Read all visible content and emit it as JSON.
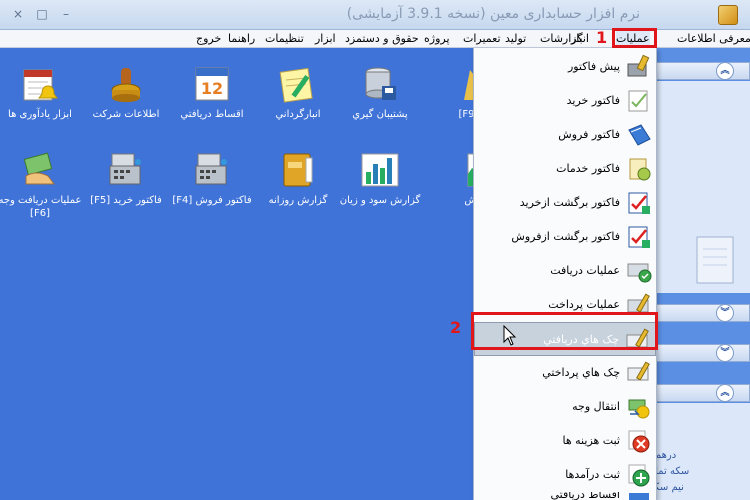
{
  "window": {
    "title": "نرم افزار حسابداری معین (نسخه 3.9.1 آزمایشی)",
    "controls": [
      "–",
      "□",
      "×"
    ]
  },
  "menubar": {
    "items": [
      "معرفی اطلاعات",
      "عملیات",
      "انبار",
      "گزارشات",
      "تولید",
      "تعمیرات",
      "پروژه",
      "حقوق و دستمزد",
      "ابزار",
      "تنظیمات",
      "راهنما",
      "خروج"
    ],
    "active": "عملیات",
    "callout_number": "1"
  },
  "desktop": {
    "row1": [
      {
        "label": "ابزار یادآوری ها",
        "icon": "calendar-bell-icon"
      },
      {
        "label": "اطلاعات شرکت",
        "icon": "stamp-icon"
      },
      {
        "label": "اقساط دريافتي",
        "icon": "calendar-12-icon"
      },
      {
        "label": "انبارگرداني",
        "icon": "notepad-pencil-icon"
      },
      {
        "label": "پشتيبان گيري",
        "icon": "database-save-icon"
      },
      {
        "label": "د ها [F9]",
        "icon": "folder-icon"
      }
    ],
    "row2": [
      {
        "label": "عمليات دريافت وجه [F6]",
        "icon": "hand-money-icon"
      },
      {
        "label": "فاکتور خريد [F5]",
        "icon": "cash-register-icon"
      },
      {
        "label": "فاکتور فروش [F4]",
        "icon": "cash-register-icon"
      },
      {
        "label": "گزارش روزانه",
        "icon": "book-icon"
      },
      {
        "label": "گزارش سود و زيان",
        "icon": "bar-chart-icon"
      },
      {
        "label": "فروش",
        "icon": "area-chart-icon"
      }
    ]
  },
  "dropdown": {
    "items": [
      {
        "label": "پيش فاکتور",
        "icon": "pen-tool-icon"
      },
      {
        "label": "فاکتور خريد",
        "icon": "check-paper-icon"
      },
      {
        "label": "فاکتور فروش",
        "icon": "blue-book-icon"
      },
      {
        "label": "فاکتور خدمات",
        "icon": "gear-paper-icon"
      },
      {
        "label": "فاکتور برگشت ازخريد",
        "icon": "red-check-icon"
      },
      {
        "label": "فاکتور برگشت ازفروش",
        "icon": "red-check-icon"
      },
      {
        "label": "عمليات دريافت",
        "icon": "receive-check-icon"
      },
      {
        "label": "عمليات پرداخت",
        "icon": "pay-pen-icon"
      },
      {
        "label": "چک هاي دريافتي",
        "icon": "cheque-pen-icon"
      },
      {
        "label": "چک هاي پرداختي",
        "icon": "cheque-pen-icon"
      },
      {
        "label": "انتقال وجه",
        "icon": "transfer-money-icon"
      },
      {
        "label": "ثبت هزينه ها",
        "icon": "red-x-icon"
      },
      {
        "label": "ثبت درآمدها",
        "icon": "green-plus-icon"
      },
      {
        "label": "اقساط دريافتي",
        "icon": "installment-icon"
      }
    ],
    "highlighted": "چک هاي دريافتي",
    "callout_number": "2"
  },
  "right_panel": {
    "links": [
      "درهم",
      "سکه تمام",
      "نیم سکه"
    ]
  },
  "colors": {
    "background": "#3f73d8",
    "highlight": "#c8d2dd",
    "callout": "#e0161b"
  }
}
